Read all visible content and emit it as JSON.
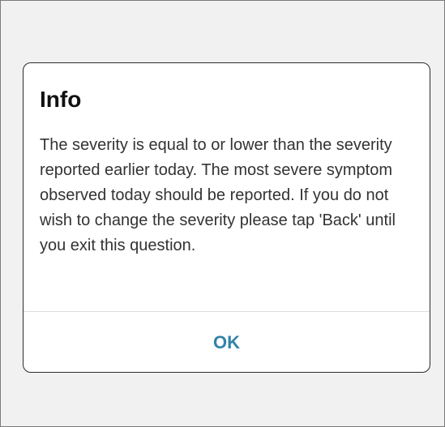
{
  "dialog": {
    "title": "Info",
    "message": "The severity is equal to or lower than the severity reported earlier today. The most severe symptom observed today should be reported. If you do not wish to change the severity please tap 'Back' until you exit this question.",
    "ok_label": "OK"
  },
  "colors": {
    "accent": "#3183a8",
    "backdrop": "#f1f1f1",
    "dialog_background": "#ffffff",
    "divider": "#dcdcdc"
  }
}
